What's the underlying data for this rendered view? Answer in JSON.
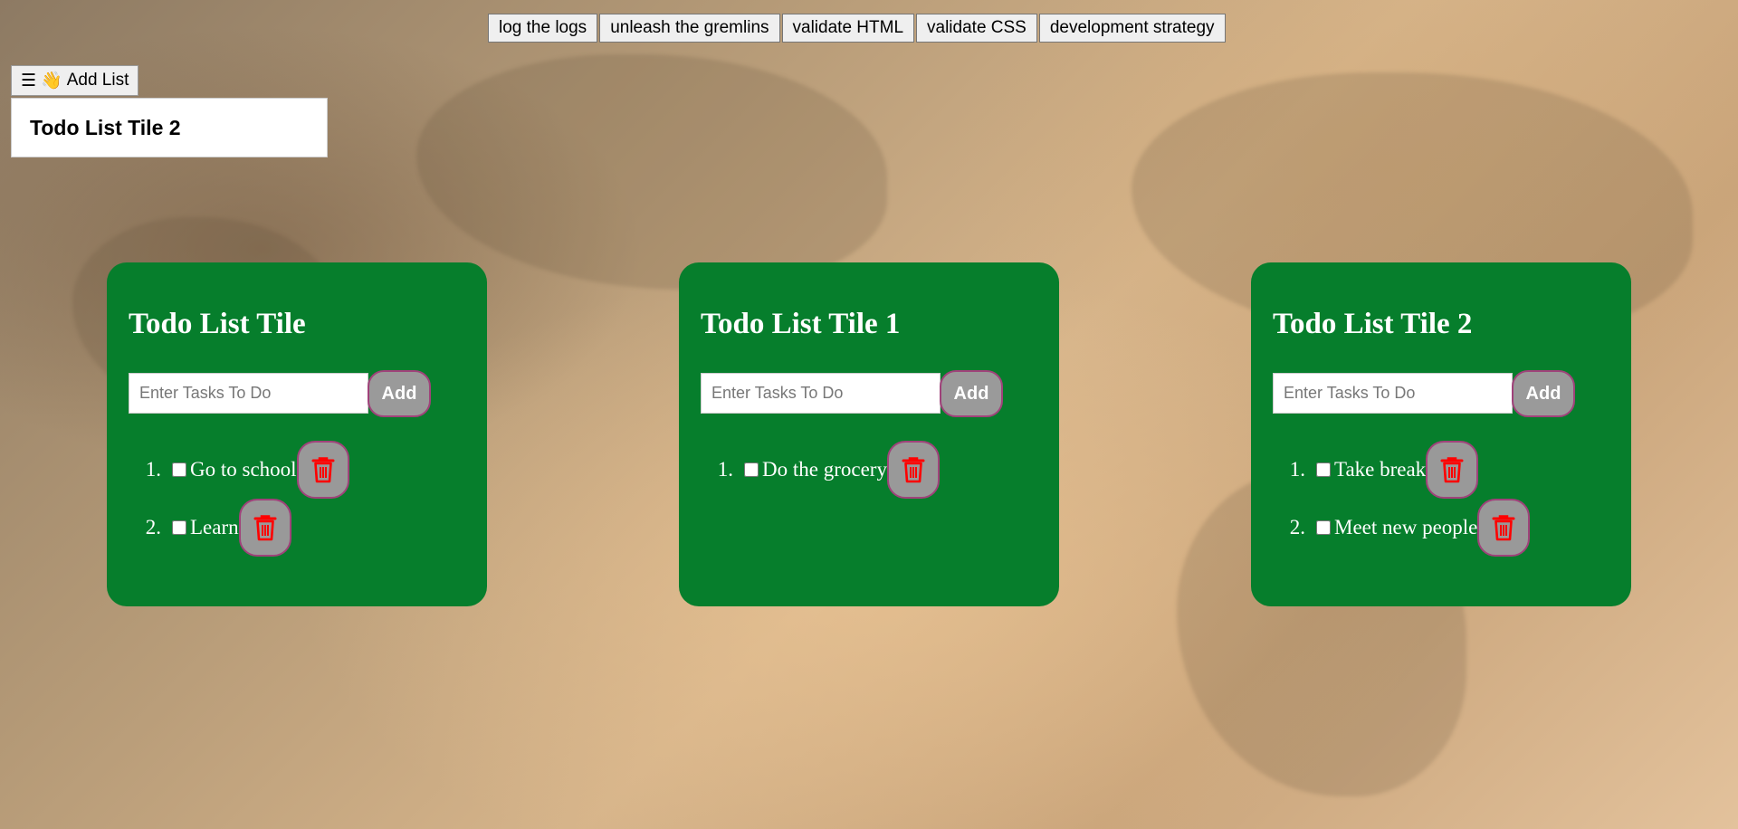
{
  "topbar": {
    "buttons": [
      "log the logs",
      "unleash the gremlins",
      "validate HTML",
      "validate CSS",
      "development strategy"
    ]
  },
  "menu": {
    "menu_glyph": "☰",
    "wave_glyph": "👋",
    "label": "Add List"
  },
  "dropdown": {
    "item": "Todo List Tile 2"
  },
  "tiles": [
    {
      "title": "Todo List Tile",
      "placeholder": "Enter Tasks To Do",
      "add_label": "Add",
      "tasks": [
        {
          "number": "1.",
          "text": "Go to school"
        },
        {
          "number": "2.",
          "text": "Learn"
        }
      ]
    },
    {
      "title": "Todo List Tile 1",
      "placeholder": "Enter Tasks To Do",
      "add_label": "Add",
      "tasks": [
        {
          "number": "1.",
          "text": "Do the grocery"
        }
      ]
    },
    {
      "title": "Todo List Tile 2",
      "placeholder": "Enter Tasks To Do",
      "add_label": "Add",
      "tasks": [
        {
          "number": "1.",
          "text": "Take break"
        },
        {
          "number": "2.",
          "text": "Meet new people"
        }
      ]
    }
  ],
  "colors": {
    "tile_bg": "#067e2c",
    "button_grey": "#999999",
    "button_border": "#a0427a",
    "trash_red": "#ff0000"
  },
  "icons": {
    "delete": "trash-icon"
  }
}
